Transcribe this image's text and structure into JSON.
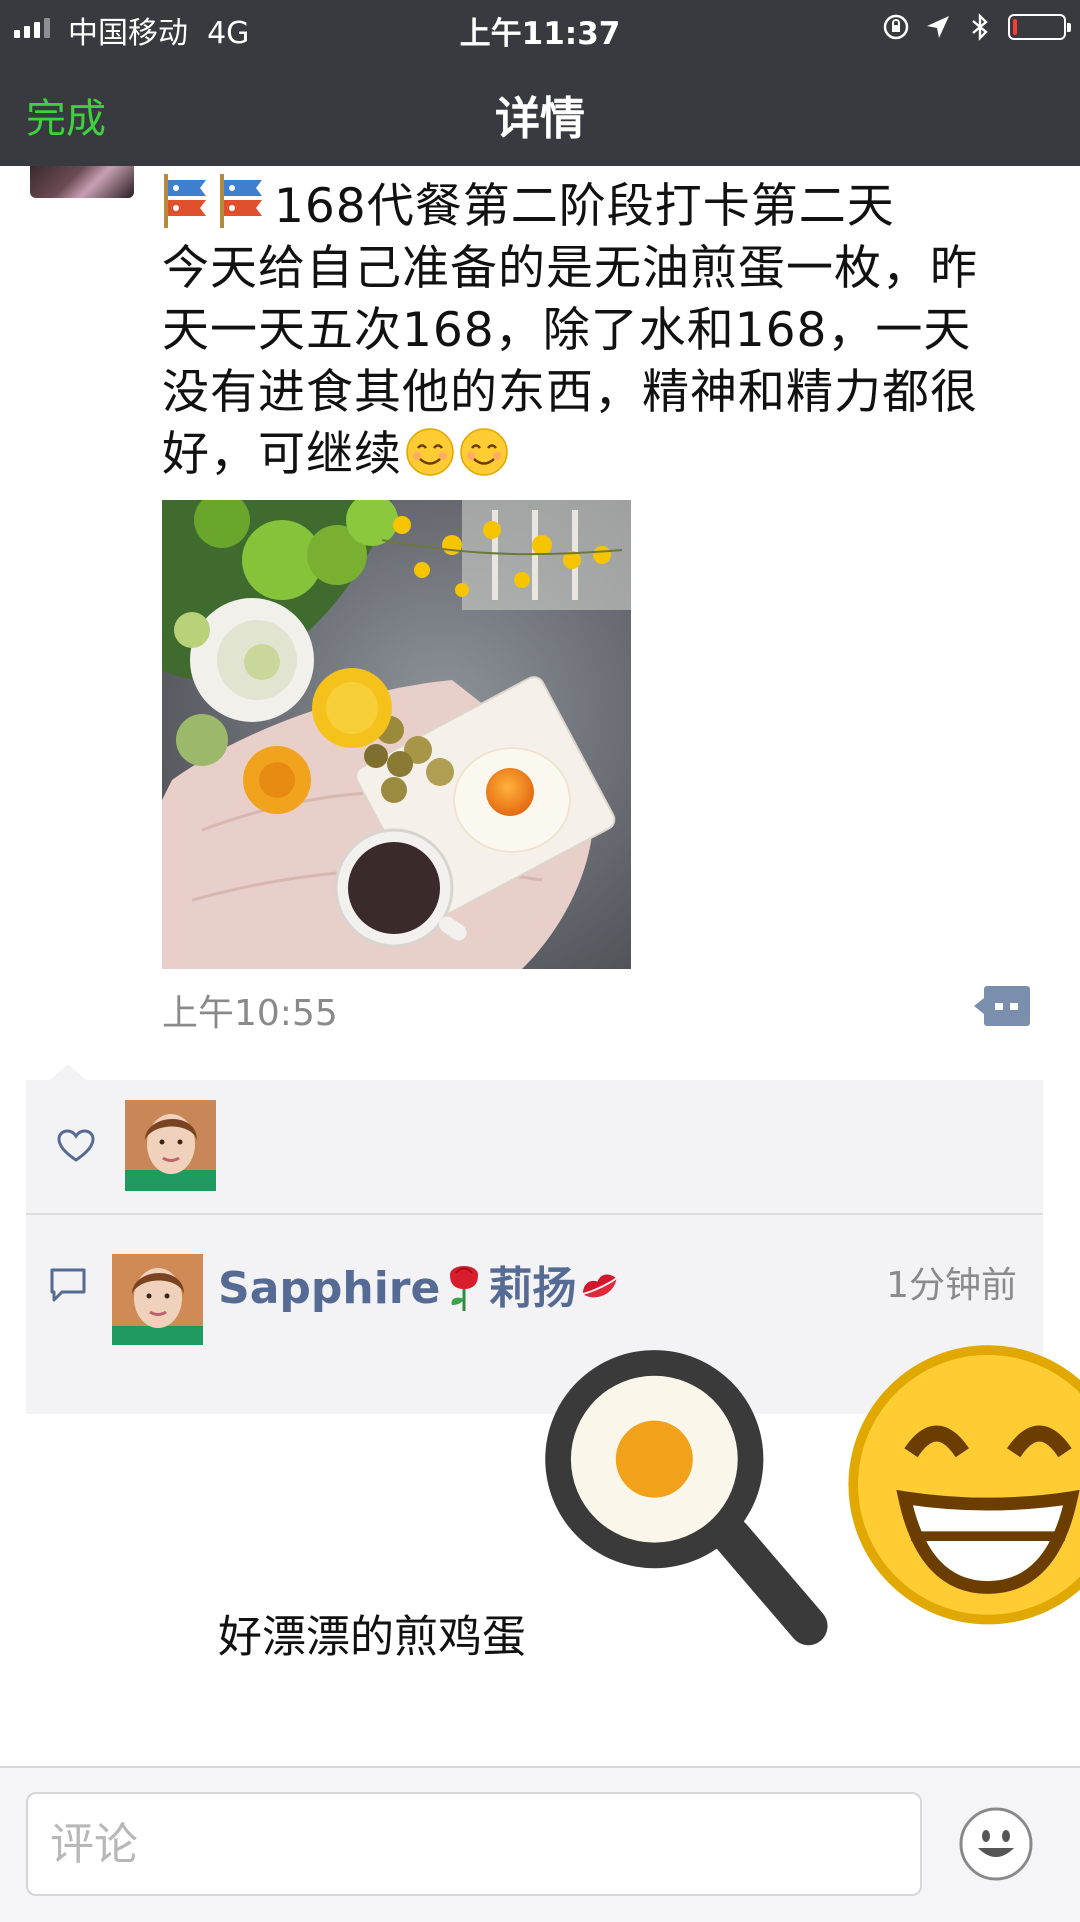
{
  "status_bar": {
    "carrier": "中国移动",
    "network": "4G",
    "time": "上午11:37",
    "battery_level_fraction": 0.08
  },
  "nav": {
    "back_label": "完成",
    "title": "详情",
    "accent_color": "#3ed03e"
  },
  "post": {
    "lines": [
      "168代餐第二阶段打卡第二天",
      "今天给自己准备的是无油煎蛋一枚，昨",
      "天一天五次168，除了水和168，一天",
      "没有进食其他的东西，精神和精力都很",
      "好，可继续"
    ],
    "time": "上午10:55",
    "icons": [
      "carp-streamer-flag-icon",
      "carp-streamer-flag-icon",
      "smiling-face-icon",
      "smiling-face-icon"
    ]
  },
  "likes": {
    "icon": "heart-icon"
  },
  "comments": [
    {
      "author": "Sapphire",
      "author_suffix": "莉扬",
      "author_icons": [
        "rose-icon",
        "kiss-mark-icon"
      ],
      "time": "1分钟前",
      "text": "好漂漂的煎鸡蛋",
      "text_icons": [
        "magnifier-egg-icon",
        "grinning-face-icon"
      ]
    }
  ],
  "input": {
    "placeholder": "评论"
  },
  "colors": {
    "nav_bg": "#393a3f",
    "link_name": "#566b94",
    "comment_box_bg": "#f3f3f5"
  }
}
